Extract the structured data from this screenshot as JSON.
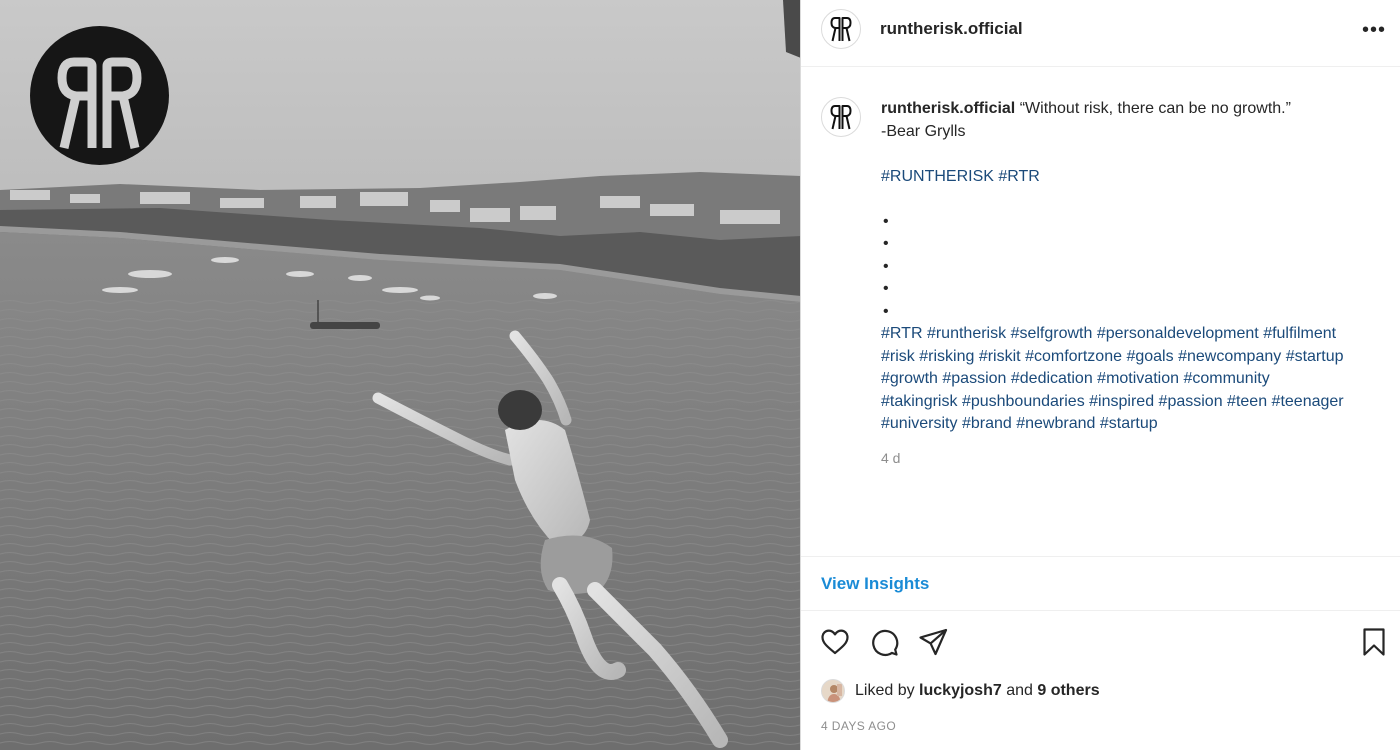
{
  "photo": {
    "logo_icon": "runtherisk-rr-logo",
    "alt": "black and white photo of a person diving off a cliff into a bay"
  },
  "header": {
    "avatar_icon": "runtherisk-rr-logo",
    "username": "runtherisk.official",
    "more_icon": "more-horizontal-icon",
    "more_label": "•••"
  },
  "caption": {
    "username": "runtherisk.official",
    "quote": "“Without risk, there can be no growth.”",
    "author": "-Bear Grylls",
    "brand_tags": [
      "#RUNTHERISK",
      "#RTR"
    ],
    "bullets": [
      "•",
      "•",
      "•",
      "•",
      "•"
    ],
    "hashtags": [
      "#RTR",
      "#runtherisk",
      "#selfgrowth",
      "#personaldevelopment",
      "#fulfilment",
      "#risk",
      "#risking",
      "#riskit",
      "#comfortzone",
      "#goals",
      "#newcompany",
      "#startup",
      "#growth",
      "#passion",
      "#dedication",
      "#motivation",
      "#community",
      "#takingrisk",
      "#pushboundaries",
      "#inspired",
      "#passion",
      "#teen",
      "#teenager",
      "#university",
      "#brand",
      "#newbrand",
      "#startup"
    ],
    "age": "4 d"
  },
  "insights": {
    "label": "View Insights"
  },
  "actions": {
    "like_icon": "heart-icon",
    "comment_icon": "comment-icon",
    "share_icon": "paper-plane-icon",
    "save_icon": "bookmark-icon"
  },
  "likes": {
    "prefix": "Liked by",
    "user": "luckyjosh7",
    "conjunction": "and",
    "others": "9 others"
  },
  "posted": "4 DAYS AGO",
  "colors": {
    "hashtag": "#1b4a7a",
    "insights": "#1a8bd6",
    "muted": "#8e8e8e",
    "border": "#efefef"
  }
}
